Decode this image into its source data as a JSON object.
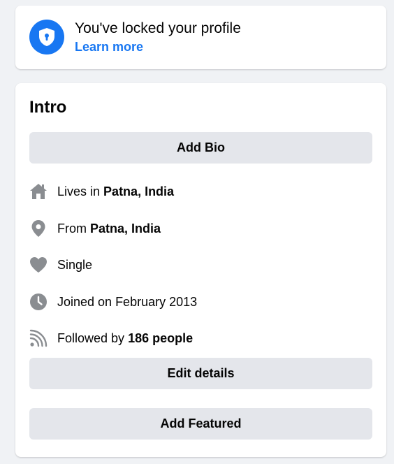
{
  "lock_notice": {
    "title": "You've locked your profile",
    "link": "Learn more",
    "icon": "shield-lock-icon",
    "accent_color": "#1877f2"
  },
  "intro": {
    "title": "Intro",
    "add_bio_label": "Add Bio",
    "details": {
      "lives_prefix": "Lives in ",
      "lives_value": "Patna, India",
      "from_prefix": "From ",
      "from_value": "Patna, India",
      "relationship": "Single",
      "joined": "Joined on February 2013",
      "followed_prefix": "Followed by ",
      "followed_value": "186 people"
    },
    "edit_details_label": "Edit details",
    "add_featured_label": "Add Featured"
  },
  "icons": {
    "lives": "home-icon",
    "from": "location-pin-icon",
    "relationship": "heart-icon",
    "joined": "clock-icon",
    "followed": "rss-feed-icon"
  },
  "colors": {
    "icon_gray": "#8a8d91",
    "button_bg": "#e4e6eb",
    "page_bg": "#f0f2f5"
  }
}
